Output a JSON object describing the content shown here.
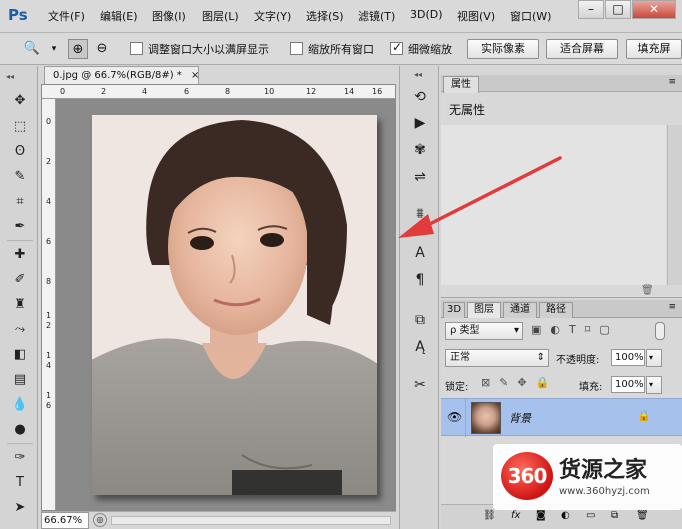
{
  "app": {
    "logo": "Ps"
  },
  "menubar": {
    "items": [
      "文件(F)",
      "编辑(E)",
      "图像(I)",
      "图层(L)",
      "文字(Y)",
      "选择(S)",
      "滤镜(T)",
      "3D(D)",
      "视图(V)",
      "窗口(W)"
    ],
    "window_buttons": [
      "–",
      "□",
      "✕"
    ]
  },
  "options_bar": {
    "resize_windows_label": "调整窗口大小以满屏显示",
    "resize_windows_checked": false,
    "zoom_all_label": "缩放所有窗口",
    "zoom_all_checked": false,
    "scrubby_zoom_label": "细微缩放",
    "scrubby_zoom_checked": true,
    "actual_pixels_button": "实际像素",
    "fit_screen_button": "适合屏幕",
    "fill_screen_button": "填充屏"
  },
  "document": {
    "tab_title": "0.jpg @ 66.7%(RGB/8#) *",
    "close_glyph": "×",
    "ruler_top": [
      "0",
      "2",
      "4",
      "6",
      "8",
      "10",
      "12",
      "14",
      "16"
    ],
    "ruler_left": [
      "0",
      "2",
      "4",
      "6",
      "8",
      "1",
      "2",
      "1",
      "4",
      "1",
      "6"
    ],
    "zoom": "66.67%"
  },
  "properties_panel": {
    "tab": "属性",
    "content": "无属性"
  },
  "layers_panel": {
    "tabs": [
      "3D",
      "图层",
      "通道",
      "路径"
    ],
    "active_tab": "图层",
    "filter_kind": "类型",
    "blend_mode": "正常",
    "opacity_label": "不透明度:",
    "opacity_value": "100%",
    "lock_label": "锁定:",
    "fill_label": "填充:",
    "fill_value": "100%",
    "layers": [
      {
        "name": "背景",
        "visible": true,
        "locked": true
      }
    ],
    "footer_icons": [
      "link-icon",
      "fx-icon",
      "mask-icon",
      "adjustment-icon",
      "group-icon",
      "new-layer-icon",
      "trash-icon"
    ]
  },
  "watermark": {
    "badge": "360",
    "title": "货源之家",
    "url": "www.360hyzj.com"
  },
  "colors": {
    "layer_selected": "#a6c2ec",
    "annotation_arrow": "#e23b3b",
    "ps_logo": "#1a5fa8"
  }
}
